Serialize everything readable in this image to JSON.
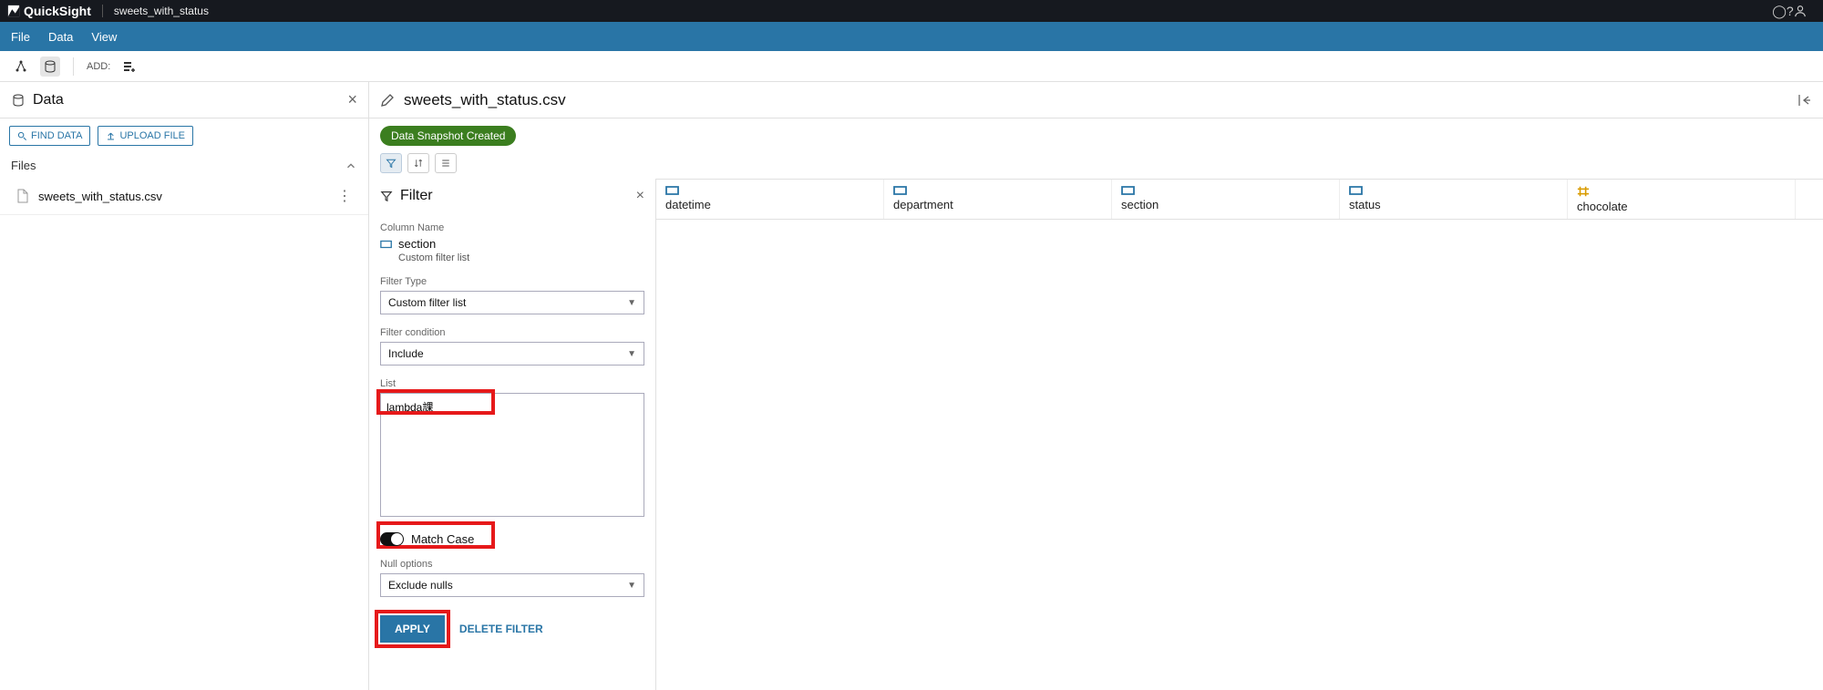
{
  "topbar": {
    "brand": "QuickSight",
    "document": "sweets_with_status"
  },
  "menubar": {
    "file": "File",
    "data": "Data",
    "view": "View"
  },
  "toolbar": {
    "add_label": "ADD:"
  },
  "sidebar": {
    "title": "Data",
    "find_data": "FIND DATA",
    "upload_file": "UPLOAD FILE",
    "files_label": "Files",
    "file0": "sweets_with_status.csv"
  },
  "content": {
    "filename": "sweets_with_status.csv",
    "badge": "Data Snapshot Created"
  },
  "filter": {
    "title": "Filter",
    "column_name_label": "Column Name",
    "column_value": "section",
    "column_sub": "Custom filter list",
    "filter_type_label": "Filter Type",
    "filter_type_value": "Custom filter list",
    "filter_condition_label": "Filter condition",
    "filter_condition_value": "Include",
    "list_label": "List",
    "list_value": "lambda課",
    "match_case_label": "Match Case",
    "null_options_label": "Null options",
    "null_options_value": "Exclude nulls",
    "apply_label": "APPLY",
    "delete_label": "DELETE FILTER"
  },
  "columns": {
    "c0": "datetime",
    "c1": "department",
    "c2": "section",
    "c3": "status",
    "c4": "chocolate"
  }
}
